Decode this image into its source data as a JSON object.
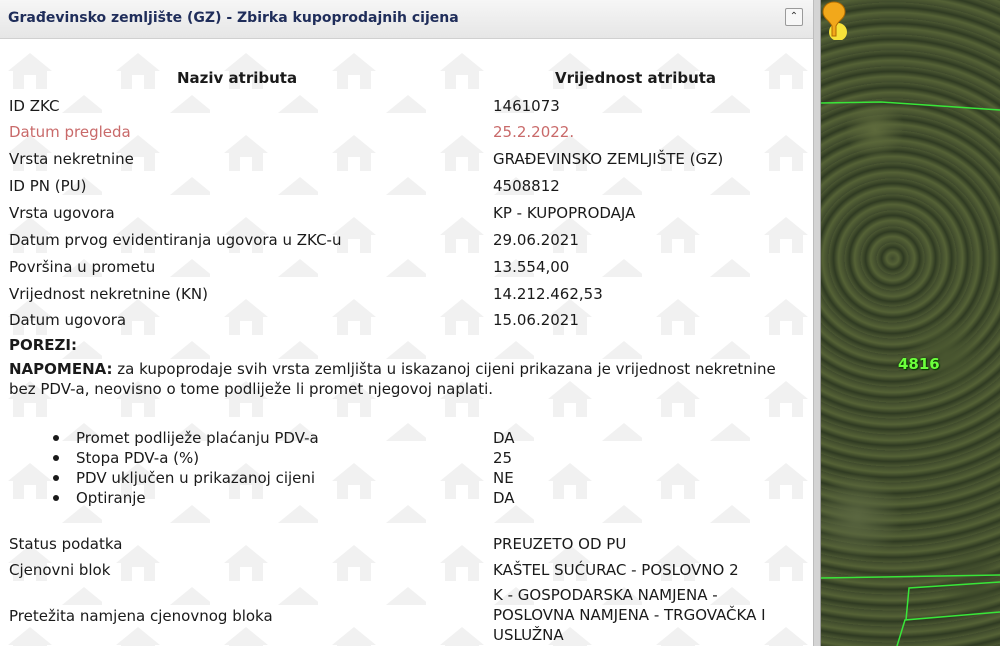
{
  "panel": {
    "title": "Građevinsko zemljište (GZ) - Zbirka kupoprodajnih cijena",
    "collapse_icon": "chevron-up-double-icon",
    "header_name": "Naziv atributa",
    "header_value": "Vrijednost atributa"
  },
  "attributes": [
    {
      "label": "ID ZKC",
      "value": "1461073"
    },
    {
      "label": "Datum pregleda",
      "value": "25.2.2022.",
      "color": "#c96a6a"
    },
    {
      "label": "Vrsta nekretnine",
      "value": "GRAĐEVINSKO ZEMLJIŠTE (GZ)"
    },
    {
      "label": "ID PN (PU)",
      "value": "4508812"
    },
    {
      "label": "Vrsta ugovora",
      "value": "KP - KUPOPRODAJA"
    },
    {
      "label": "Datum prvog evidentiranja ugovora u ZKC-u",
      "value": "29.06.2021"
    },
    {
      "label": "Površina u prometu",
      "value": "13.554,00"
    },
    {
      "label": "Vrijednost nekretnine (KN)",
      "value": "14.212.462,53"
    },
    {
      "label": "Datum ugovora",
      "value": "15.06.2021"
    }
  ],
  "taxes": {
    "heading": "POREZI:",
    "note_bold": "NAPOMENA:",
    "note_text": " za kupoprodaje svih vrsta zemljišta u iskazanoj cijeni prikazana je vrijednost nekretnine bez PDV-a, neovisno o tome podliježe li promet njegovoj naplati.",
    "items": [
      {
        "label": "Promet podliježe plaćanju PDV-a",
        "value": "DA"
      },
      {
        "label": "Stopa PDV-a (%)",
        "value": "25"
      },
      {
        "label": "PDV uključen u prikazanoj cijeni",
        "value": "NE"
      },
      {
        "label": "Optiranje",
        "value": "DA"
      }
    ]
  },
  "extra": [
    {
      "label": "Status podatka",
      "value": "PREUZETO OD PU"
    },
    {
      "label": "Cjenovni blok",
      "value": "KAŠTEL SUĆURAC - POSLOVNO 2"
    },
    {
      "label": "Pretežita namjena cjenovnog bloka",
      "value": "K - GOSPODARSKA NAMJENA - POSLOVNA NAMJENA - TRGOVAČKA I USLUŽNA"
    }
  ],
  "map": {
    "parcel_label": "4816",
    "marker_icon": "map-pin-icon",
    "boundary_color": "#39e639",
    "label_color": "#6cff3c"
  }
}
